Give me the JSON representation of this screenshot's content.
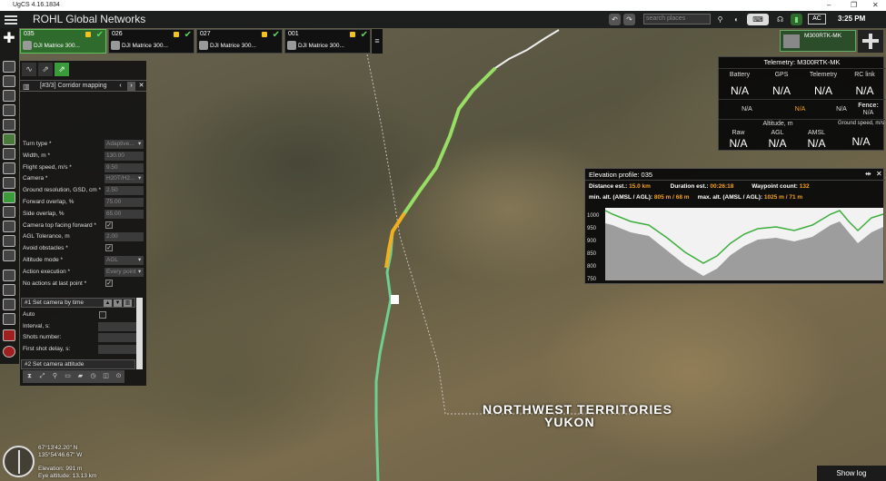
{
  "window": {
    "title": "UgCS 4.16.1834",
    "controls": [
      "–",
      "❐",
      "✕"
    ]
  },
  "header": {
    "app_title": "ROHL Global Networks",
    "search_placeholder": "search places",
    "ac_label": "AC",
    "time": "3:25 PM"
  },
  "vehicles": [
    {
      "id": "035",
      "name": "DJI Matrice 300...",
      "selected": true
    },
    {
      "id": "026",
      "name": "DJI Matrice 300...",
      "selected": false
    },
    {
      "id": "027",
      "name": "DJI Matrice 300...",
      "selected": false
    },
    {
      "id": "001",
      "name": "DJI Matrice 300...",
      "selected": false
    }
  ],
  "right_vehicle": {
    "name": "M300RTK-MK"
  },
  "panel": {
    "header": "[#3/3] Corridor mapping",
    "params": [
      {
        "label": "Turn type *",
        "value": "Adaptive...",
        "kind": "select"
      },
      {
        "label": "Width, m *",
        "value": "130.00",
        "kind": "input"
      },
      {
        "label": "Flight speed, m/s *",
        "value": "9.50",
        "kind": "input"
      },
      {
        "label": "Camera *",
        "value": "H20T/H2...",
        "kind": "select"
      },
      {
        "label": "Ground resolution, GSD, cm *",
        "value": "2.50",
        "kind": "input"
      },
      {
        "label": "Forward overlap, %",
        "value": "75.00",
        "kind": "input"
      },
      {
        "label": "Side overlap, %",
        "value": "65.00",
        "kind": "input"
      },
      {
        "label": "Camera top facing forward *",
        "value": "✓",
        "kind": "check"
      },
      {
        "label": "AGL Tolerance, m",
        "value": "2.00",
        "kind": "input"
      },
      {
        "label": "Avoid obstacles *",
        "value": "✓",
        "kind": "check"
      },
      {
        "label": "Altitude mode *",
        "value": "AGL",
        "kind": "select"
      },
      {
        "label": "Action execution *",
        "value": "Every point",
        "kind": "select"
      },
      {
        "label": "No actions at last point *",
        "value": "✓",
        "kind": "check"
      }
    ],
    "action1": {
      "title": "#1 Set camera by time"
    },
    "action1_rows": [
      {
        "label": "Auto",
        "kind": "check"
      },
      {
        "label": "Interval, s:",
        "kind": "input"
      },
      {
        "label": "Shots number:",
        "kind": "input"
      },
      {
        "label": "First shot delay, s:",
        "kind": "input"
      }
    ],
    "action2": {
      "title": "#2 Set camera attitude"
    }
  },
  "telemetry": {
    "title": "Telemetry: M300RTK-MK",
    "headers": [
      "Battery",
      "GPS",
      "Telemetry",
      "RC link"
    ],
    "values": [
      "N/A",
      "N/A",
      "N/A",
      "N/A"
    ],
    "row2": [
      "N/A",
      "N/A",
      "N/A"
    ],
    "fence_label": "Fence:",
    "fence_value": "N/A",
    "altitude_label": "Altitude, m",
    "alt_headers": [
      "Raw",
      "AGL",
      "AMSL"
    ],
    "alt_values": [
      "N/A",
      "N/A",
      "N/A"
    ],
    "gs_label": "Ground speed, m/s",
    "gs_value": "N/A"
  },
  "elevation": {
    "title": "Elevation profile: 035",
    "distance_label": "Distance est.:",
    "distance": "15.0 km",
    "duration_label": "Duration est.:",
    "duration": "00:26:18",
    "waypoint_label": "Waypoint count:",
    "waypoints": "132",
    "minalt_label": "min. alt. (AMSL / AGL):",
    "minalt": "805 m / 68 m",
    "maxalt_label": "max. alt. (AMSL / AGL):",
    "maxalt": "1025 m / 71 m",
    "yticks": [
      "1000",
      "950",
      "900",
      "850",
      "800",
      "750"
    ]
  },
  "map": {
    "territory1": "NORTHWEST TERRITORIES",
    "territory2": "YUKON",
    "coord1": "67°13'42.20\" N",
    "coord2": "135°54'46.67\" W",
    "elevation_readout": "Elevation: 991 m",
    "eye_altitude": "Eye altitude: 13.13 km",
    "show_log": "Show log"
  }
}
